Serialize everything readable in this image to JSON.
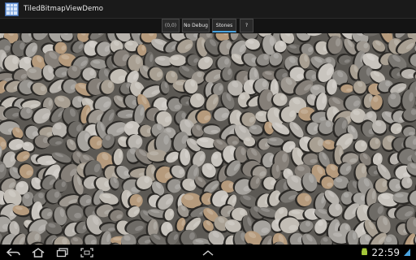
{
  "app": {
    "title": "TiledBitmapViewDemo",
    "icon": "tiles-grid-icon"
  },
  "actionbar": {
    "coords_label": "(0,0)",
    "debug_label": "No Debug",
    "bitmap_label": "Stones",
    "help_label": "?"
  },
  "viewer": {
    "content": "stones-bitmap-tiles"
  },
  "navbar": {
    "back_icon": "back-arrow-icon",
    "home_icon": "home-icon",
    "recent_icon": "recent-apps-icon",
    "screenshot_icon": "screenshot-icon",
    "menu_icon": "chevron-up-icon"
  },
  "status": {
    "time": "22:59",
    "notification_icon": "android-notification-icon",
    "signal_icon": "wifi-signal-icon",
    "accent_color": "#4aa3df"
  }
}
